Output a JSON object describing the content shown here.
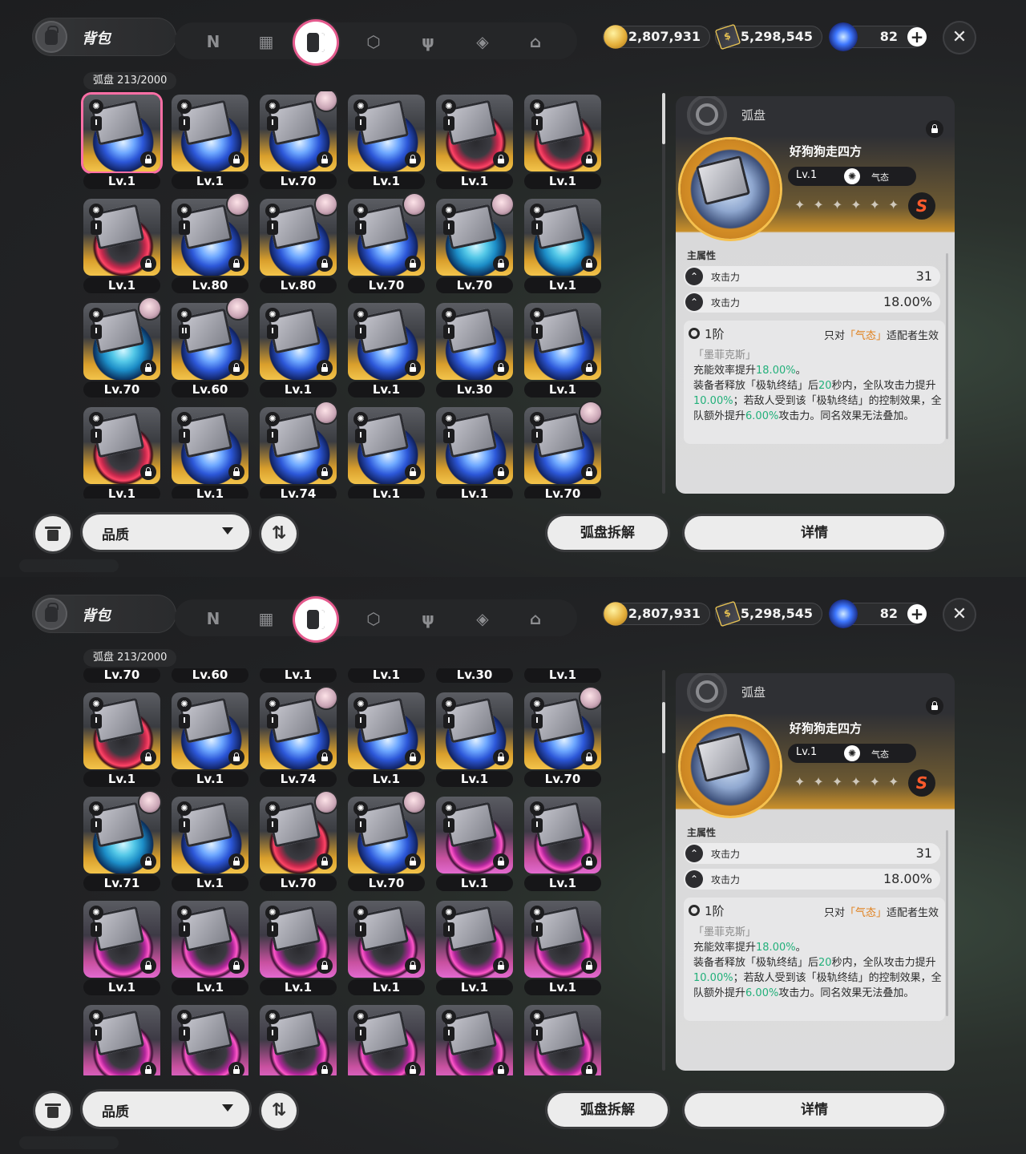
{
  "screens": [
    {
      "bag_title": "背包",
      "tabs": [
        {
          "icon": "n-logo-icon",
          "glyph": "N"
        },
        {
          "icon": "gameboy-icon",
          "glyph": "▦"
        },
        {
          "icon": "disc-case-icon",
          "glyph": "",
          "active": true
        },
        {
          "icon": "cube-icon",
          "glyph": "⬡"
        },
        {
          "icon": "fork-knife-icon",
          "glyph": "ψ"
        },
        {
          "icon": "package-icon",
          "glyph": "◈"
        },
        {
          "icon": "house-icon",
          "glyph": "⌂"
        }
      ],
      "currency": {
        "coins": "2,807,931",
        "tickets": "5,298,545",
        "orbs": "82"
      },
      "count_label": "弧盘 213/2000",
      "scroll_offset_rows": 0,
      "filter_label": "品质",
      "dismantle_label": "弧盘拆解",
      "detail_label": "详情"
    },
    {
      "bag_title": "背包",
      "tabs": [
        {
          "icon": "n-logo-icon",
          "glyph": "N"
        },
        {
          "icon": "gameboy-icon",
          "glyph": "▦"
        },
        {
          "icon": "disc-case-icon",
          "glyph": "",
          "active": true
        },
        {
          "icon": "cube-icon",
          "glyph": "⬡"
        },
        {
          "icon": "fork-knife-icon",
          "glyph": "ψ"
        },
        {
          "icon": "package-icon",
          "glyph": "◈"
        },
        {
          "icon": "house-icon",
          "glyph": "⌂"
        }
      ],
      "currency": {
        "coins": "2,807,931",
        "tickets": "5,298,545",
        "orbs": "82"
      },
      "count_label": "弧盘 213/2000",
      "scroll_offset_rows": 2,
      "filter_label": "品质",
      "dismantle_label": "弧盘拆解",
      "detail_label": "详情"
    }
  ],
  "grid_screen_0": [
    [
      {
        "lv": "Lv.1",
        "slot": "I",
        "rar": "A",
        "disc": "blue",
        "sel": true
      },
      {
        "lv": "Lv.1",
        "slot": "I",
        "rar": "A",
        "disc": "blue"
      },
      {
        "lv": "Lv.70",
        "slot": "I",
        "rar": "A",
        "disc": "blue",
        "av": true
      },
      {
        "lv": "Lv.1",
        "slot": "I",
        "rar": "A",
        "disc": "blue"
      },
      {
        "lv": "Lv.1",
        "slot": "I",
        "rar": "A",
        "disc": "red"
      },
      {
        "lv": "Lv.1",
        "slot": "I",
        "rar": "A",
        "disc": "red"
      }
    ],
    [
      {
        "lv": "Lv.1",
        "slot": "I",
        "rar": "A",
        "disc": "red"
      },
      {
        "lv": "Lv.80",
        "slot": "I",
        "rar": "A",
        "disc": "blue",
        "av": true
      },
      {
        "lv": "Lv.80",
        "slot": "I",
        "rar": "A",
        "disc": "blue",
        "av": true
      },
      {
        "lv": "Lv.70",
        "slot": "I",
        "rar": "A",
        "disc": "blue",
        "av": true
      },
      {
        "lv": "Lv.70",
        "slot": "I",
        "rar": "A",
        "disc": "cyan",
        "av": true
      },
      {
        "lv": "Lv.1",
        "slot": "I",
        "rar": "A",
        "disc": "cyan"
      }
    ],
    [
      {
        "lv": "Lv.70",
        "slot": "I",
        "rar": "A",
        "disc": "cyan",
        "av": true
      },
      {
        "lv": "Lv.60",
        "slot": "II",
        "rar": "A",
        "disc": "blue",
        "av": true
      },
      {
        "lv": "Lv.1",
        "slot": "I",
        "rar": "A",
        "disc": "blue"
      },
      {
        "lv": "Lv.1",
        "slot": "I",
        "rar": "A",
        "disc": "blue"
      },
      {
        "lv": "Lv.30",
        "slot": "I",
        "rar": "A",
        "disc": "blue"
      },
      {
        "lv": "Lv.1",
        "slot": "I",
        "rar": "A",
        "disc": "blue"
      }
    ],
    [
      {
        "lv": "Lv.1",
        "slot": "I",
        "rar": "A",
        "disc": "red"
      },
      {
        "lv": "Lv.1",
        "slot": "I",
        "rar": "A",
        "disc": "blue"
      },
      {
        "lv": "Lv.74",
        "slot": "I",
        "rar": "A",
        "disc": "blue",
        "av": true
      },
      {
        "lv": "Lv.1",
        "slot": "I",
        "rar": "A",
        "disc": "blue"
      },
      {
        "lv": "Lv.1",
        "slot": "I",
        "rar": "A",
        "disc": "blue"
      },
      {
        "lv": "Lv.70",
        "slot": "I",
        "rar": "A",
        "disc": "blue",
        "av": true
      }
    ]
  ],
  "grid_screen_1": [
    [
      {
        "lv": "Lv.70",
        "slot": "I",
        "rar": "A",
        "disc": "cyan",
        "av": true
      },
      {
        "lv": "Lv.60",
        "slot": "II",
        "rar": "A",
        "disc": "blue",
        "av": true
      },
      {
        "lv": "Lv.1",
        "slot": "I",
        "rar": "A",
        "disc": "blue"
      },
      {
        "lv": "Lv.1",
        "slot": "I",
        "rar": "A",
        "disc": "blue"
      },
      {
        "lv": "Lv.30",
        "slot": "I",
        "rar": "A",
        "disc": "blue"
      },
      {
        "lv": "Lv.1",
        "slot": "I",
        "rar": "A",
        "disc": "blue"
      }
    ],
    [
      {
        "lv": "Lv.1",
        "slot": "I",
        "rar": "A",
        "disc": "red"
      },
      {
        "lv": "Lv.1",
        "slot": "I",
        "rar": "A",
        "disc": "blue"
      },
      {
        "lv": "Lv.74",
        "slot": "I",
        "rar": "A",
        "disc": "blue",
        "av": true
      },
      {
        "lv": "Lv.1",
        "slot": "I",
        "rar": "A",
        "disc": "blue"
      },
      {
        "lv": "Lv.1",
        "slot": "I",
        "rar": "A",
        "disc": "blue"
      },
      {
        "lv": "Lv.70",
        "slot": "I",
        "rar": "A",
        "disc": "blue",
        "av": true
      }
    ],
    [
      {
        "lv": "Lv.71",
        "slot": "I",
        "rar": "A",
        "disc": "cyan",
        "av": true
      },
      {
        "lv": "Lv.1",
        "slot": "I",
        "rar": "A",
        "disc": "blue"
      },
      {
        "lv": "Lv.70",
        "slot": "I",
        "rar": "A",
        "disc": "red",
        "av": true
      },
      {
        "lv": "Lv.70",
        "slot": "I",
        "rar": "A",
        "disc": "blue",
        "av": true
      },
      {
        "lv": "Lv.1",
        "slot": "I",
        "rar": "S",
        "disc": "pink"
      },
      {
        "lv": "Lv.1",
        "slot": "I",
        "rar": "S",
        "disc": "pink"
      }
    ],
    [
      {
        "lv": "Lv.1",
        "slot": "I",
        "rar": "S",
        "disc": "pink"
      },
      {
        "lv": "Lv.1",
        "slot": "I",
        "rar": "S",
        "disc": "pink"
      },
      {
        "lv": "Lv.1",
        "slot": "I",
        "rar": "S",
        "disc": "pink"
      },
      {
        "lv": "Lv.1",
        "slot": "I",
        "rar": "S",
        "disc": "pink"
      },
      {
        "lv": "Lv.1",
        "slot": "I",
        "rar": "S",
        "disc": "pink"
      },
      {
        "lv": "Lv.1",
        "slot": "I",
        "rar": "S",
        "disc": "pink"
      }
    ],
    [
      {
        "lv": "",
        "slot": "I",
        "rar": "S",
        "disc": "pink"
      },
      {
        "lv": "",
        "slot": "I",
        "rar": "S",
        "disc": "pink"
      },
      {
        "lv": "",
        "slot": "I",
        "rar": "S",
        "disc": "pink"
      },
      {
        "lv": "",
        "slot": "I",
        "rar": "S",
        "disc": "pink"
      },
      {
        "lv": "",
        "slot": "I",
        "rar": "S",
        "disc": "pink"
      },
      {
        "lv": "",
        "slot": "I",
        "rar": "S",
        "disc": "pink"
      }
    ]
  ],
  "detail": {
    "category": "弧盘",
    "name": "好狗狗走四方",
    "level": "Lv.1",
    "element": "气态",
    "stars": "✦✦✦✦✦✦",
    "rank": "S",
    "main_attr_title": "主属性",
    "attrs": [
      {
        "label": "攻击力",
        "value": "31"
      },
      {
        "label": "攻击力",
        "value": "18.00%"
      }
    ],
    "tier_label": "1阶",
    "tier_cond_prefix": "只对",
    "tier_cond_hl": "「气态」",
    "tier_cond_suffix": "适配者生效",
    "tier_subtitle": "「墨菲克斯」",
    "effect_line1_a": "充能效率提升",
    "effect_line1_b": "18.00%",
    "effect_line1_c": "。",
    "effect_p2_a": "装备者释放「极轨终结」后",
    "effect_p2_b": "20",
    "effect_p2_c": "秒内，全队攻击力提升",
    "effect_p2_d": "10.00%",
    "effect_p2_e": "；若敌人受到该「极轨终结」的控制效果，全队额外提升",
    "effect_p2_f": "6.00%",
    "effect_p2_g": "攻击力。同名效果无法叠加。"
  },
  "colors": {
    "accent_pink": "#ff6fa6",
    "rank_orange": "#ff5a2c",
    "highlight_green": "#22b07a",
    "highlight_orange": "#e07f1a"
  }
}
